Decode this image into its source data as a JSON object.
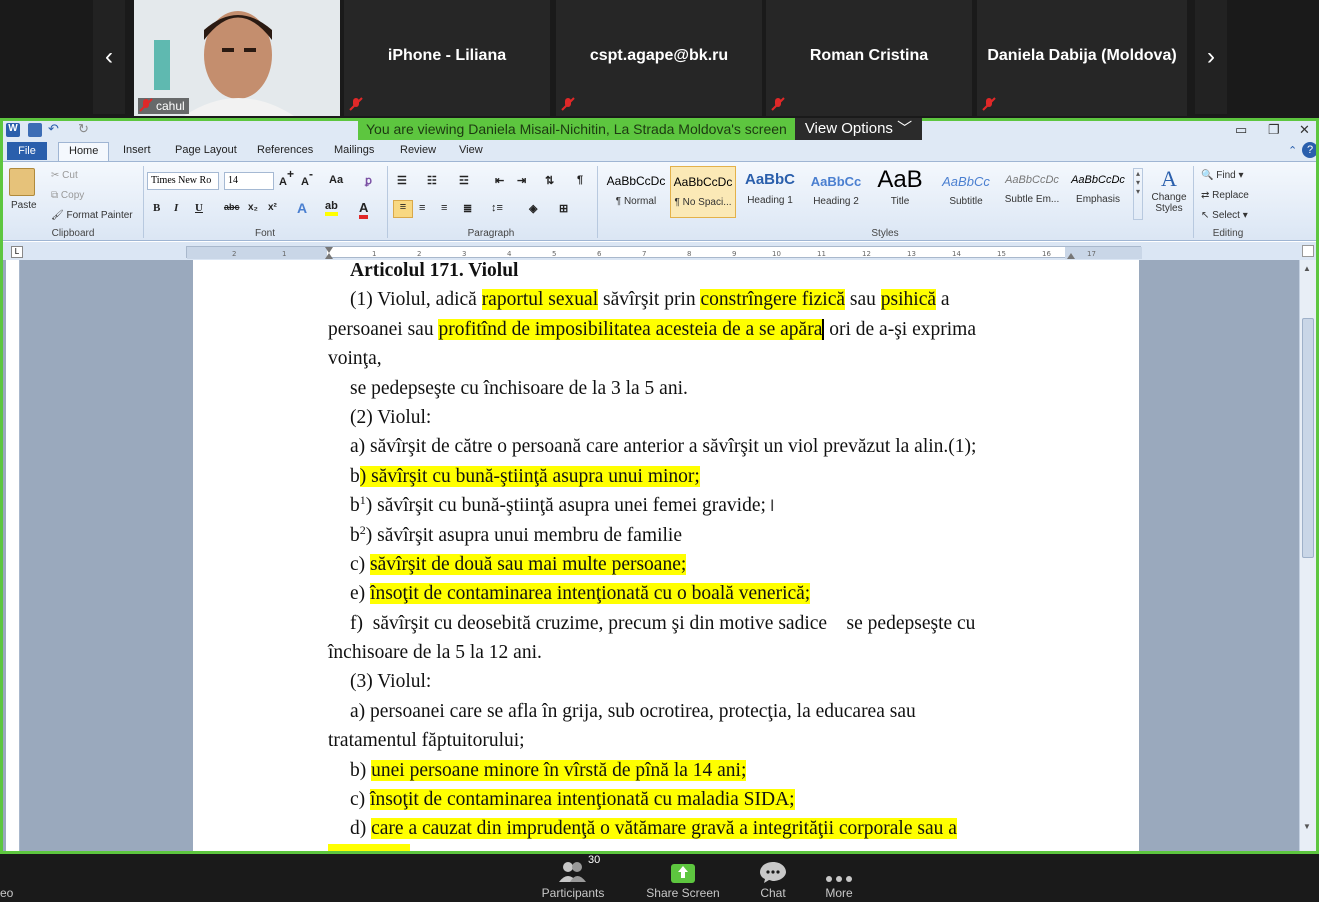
{
  "gallery": {
    "participants": [
      {
        "name": "cahul"
      },
      {
        "name": "iPhone - Liliana"
      },
      {
        "name": "cspt.agape@bk.ru"
      },
      {
        "name": "Roman Cristina"
      },
      {
        "name": "Daniela Dabija (Moldova)"
      }
    ]
  },
  "share_banner": {
    "message": "You are viewing Daniela Misail-Nichitin, La Strada Moldova's screen",
    "options_label": "View Options"
  },
  "word": {
    "tabs": [
      "File",
      "Home",
      "Insert",
      "Page Layout",
      "References",
      "Mailings",
      "Review",
      "View"
    ],
    "clipboard": {
      "paste": "Paste",
      "cut": "Cut",
      "copy": "Copy",
      "format_painter": "Format Painter",
      "label": "Clipboard"
    },
    "font": {
      "name": "Times New Ro",
      "size": "14",
      "label": "Font"
    },
    "paragraph": {
      "label": "Paragraph"
    },
    "styles": {
      "label": "Styles",
      "items": [
        {
          "sample": "AaBbCcDc",
          "name": "¶ Normal"
        },
        {
          "sample": "AaBbCcDc",
          "name": "¶ No Spaci..."
        },
        {
          "sample": "AaBbC",
          "name": "Heading 1"
        },
        {
          "sample": "AaBbCc",
          "name": "Heading 2"
        },
        {
          "sample": "AaB",
          "name": "Title"
        },
        {
          "sample": "AaBbCc",
          "name": "Subtitle"
        },
        {
          "sample": "AaBbCcDc",
          "name": "Subtle Em..."
        },
        {
          "sample": "AaBbCcDc",
          "name": "Emphasis"
        }
      ],
      "change_styles": "Change Styles"
    },
    "editing": {
      "find": "Find",
      "replace": "Replace",
      "select": "Select",
      "label": "Editing"
    }
  },
  "document": {
    "title": "Articolul 171. Violul",
    "p1_a": "(1) Violul, adică ",
    "p1_hl1": "raportul sexual",
    "p1_b": " săvîrşit prin ",
    "p1_hl2": "constrîngere fizică",
    "p1_c": " sau ",
    "p1_hl3": "psihică",
    "p1_d": " a",
    "p2_a": "persoanei sau ",
    "p2_hl": "profitînd de imposibilitatea acesteia de a se apăra",
    "p2_b": " ori de a-şi exprima",
    "p3": "voinţa,",
    "p4": "se pedepseşte cu închisoare de la 3 la 5 ani.",
    "p5": "(2) Violul:",
    "p6": "a) săvîrşit de către o persoană care anterior a săvîrşit un viol prevăzut la alin.(1);",
    "p7_a": "b",
    "p7_hl": ") săvîrşit cu bună-ştiinţă asupra unui minor;",
    "p8_a": "b",
    "p8_sup": "1",
    "p8_b": ") săvîrşit cu bună-ştiinţă asupra unei femei gravide;",
    "p9_a": "b",
    "p9_sup": "2",
    "p9_b": ") săvîrşit asupra unui membru de familie",
    "p10_a": "c) ",
    "p10_hl": "săvîrşit de două sau mai multe persoane;",
    "p11_a": "e) ",
    "p11_hl": "însoţit de contaminarea intenţionată cu o boală venerică;",
    "p12": "f)  săvîrşit cu deosebită cruzime, precum şi din motive sadice    se pedepseşte cu",
    "p13": "închisoare de la 5 la 12 ani.",
    "p14": "(3) Violul:",
    "p15": "a) persoanei care se afla în grija, sub ocrotirea, protecţia, la educarea sau",
    "p16": "tratamentul făptuitorului;",
    "p17_a": "b) ",
    "p17_hl": "unei persoane minore în vîrstă de pînă la 14 ani;",
    "p18_a": "c) ",
    "p18_hl": "însoţit de contaminarea intenţionată cu maladia SIDA;",
    "p19_a": "d) ",
    "p19_hl": "care a cauzat din imprudenţă o vătămare gravă a integrităţii corporale sau a"
  },
  "controls": {
    "left_partial": "eo",
    "participants": "Participants",
    "participants_count": "30",
    "share": "Share Screen",
    "chat": "Chat",
    "more": "More"
  },
  "colors": {
    "highlight": "#ffff00",
    "zoom_green": "#5dc63f",
    "word_blue": "#2a5fac"
  }
}
